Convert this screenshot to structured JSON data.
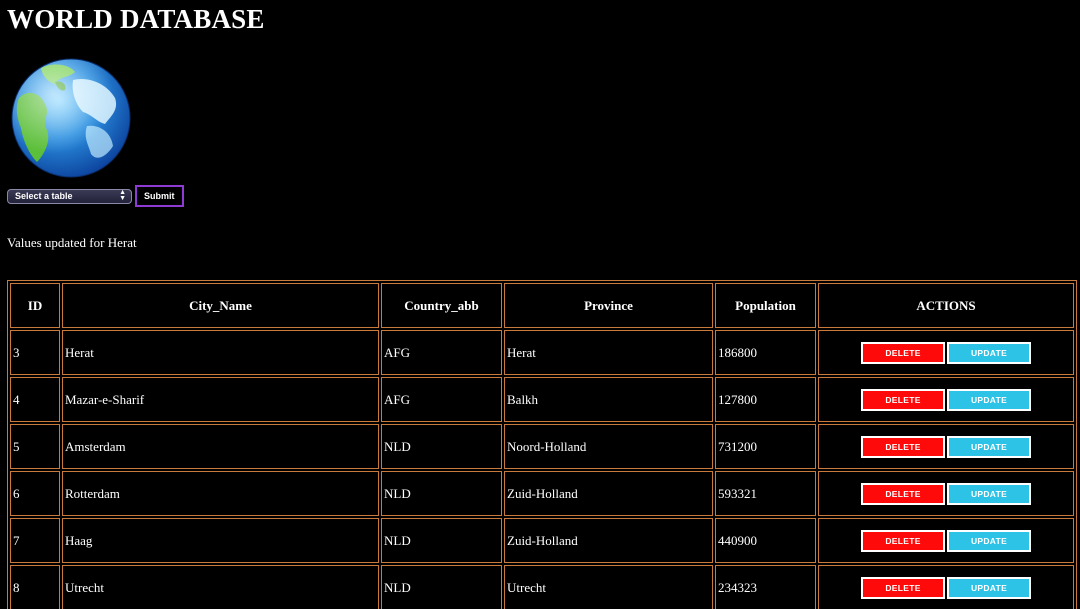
{
  "page": {
    "title": "WORLD DATABASE"
  },
  "controls": {
    "select_value": "Select a table",
    "submit_label": "Submit"
  },
  "status_message": "Values updated for Herat",
  "table": {
    "headers": [
      "ID",
      "City_Name",
      "Country_abb",
      "Province",
      "Population",
      "ACTIONS"
    ],
    "rows": [
      {
        "id": "3",
        "city": "Herat",
        "country": "AFG",
        "province": "Herat",
        "population": "186800"
      },
      {
        "id": "4",
        "city": "Mazar-e-Sharif",
        "country": "AFG",
        "province": "Balkh",
        "population": "127800"
      },
      {
        "id": "5",
        "city": "Amsterdam",
        "country": "NLD",
        "province": "Noord-Holland",
        "population": "731200"
      },
      {
        "id": "6",
        "city": "Rotterdam",
        "country": "NLD",
        "province": "Zuid-Holland",
        "population": "593321"
      },
      {
        "id": "7",
        "city": "Haag",
        "country": "NLD",
        "province": "Zuid-Holland",
        "population": "440900"
      },
      {
        "id": "8",
        "city": "Utrecht",
        "country": "NLD",
        "province": "Utrecht",
        "population": "234323"
      }
    ],
    "delete_label": "DELETE",
    "update_label": "UPDATE"
  },
  "colors": {
    "background": "#000000",
    "table_border": "#c87a3c",
    "delete_button": "#ff0a0a",
    "update_button": "#2cc3e6",
    "submit_border": "#8e3bd6"
  },
  "icons": {
    "logo": "globe-icon"
  }
}
